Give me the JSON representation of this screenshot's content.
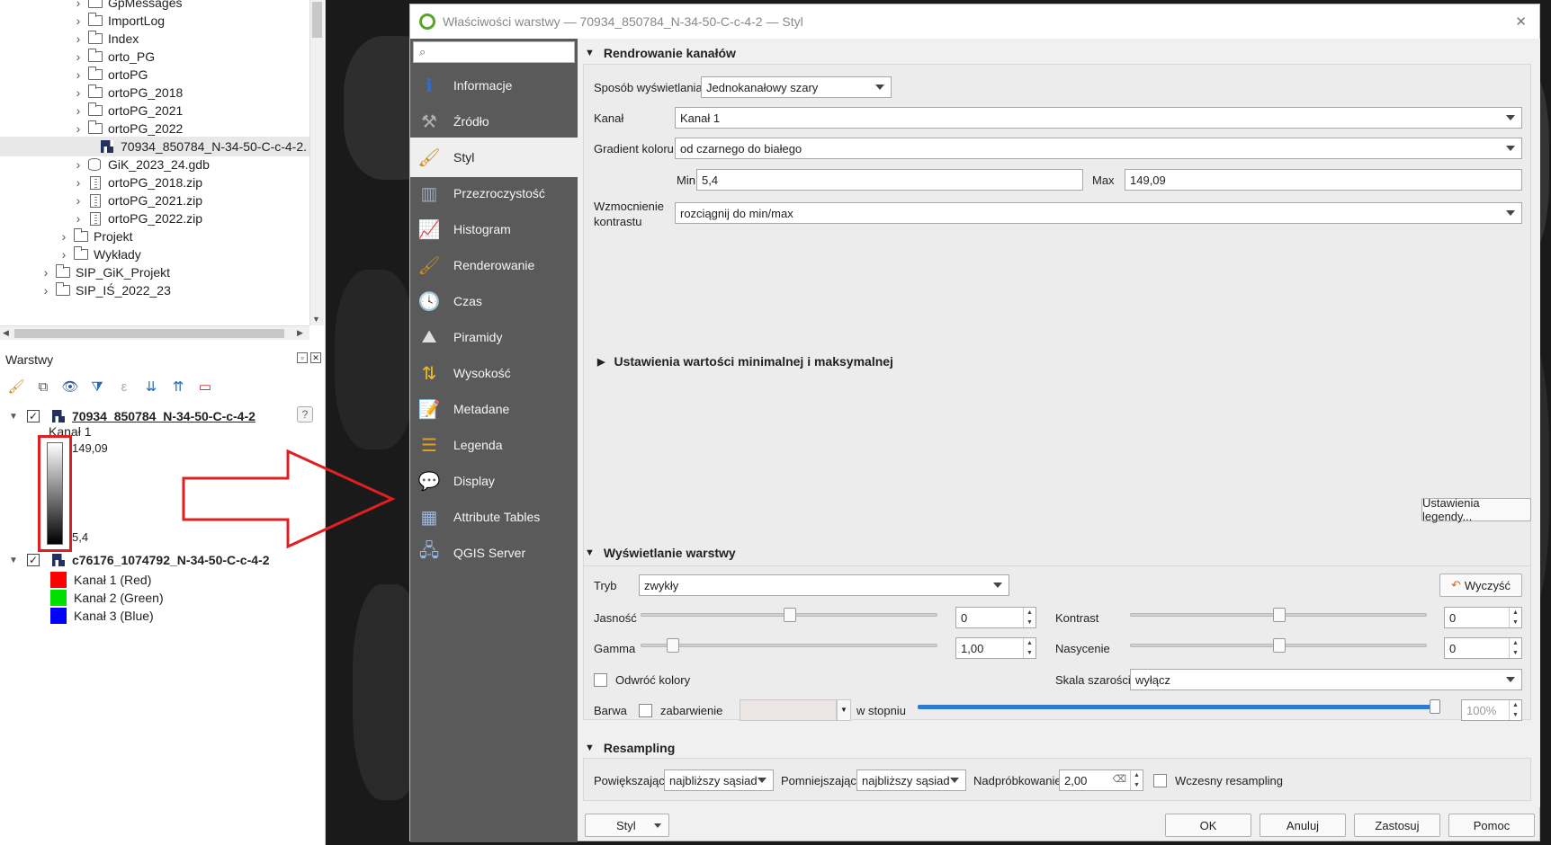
{
  "browser": {
    "items": [
      {
        "label": "GpMessages",
        "type": "folder"
      },
      {
        "label": "ImportLog",
        "type": "folder"
      },
      {
        "label": "Index",
        "type": "folder"
      },
      {
        "label": "orto_PG",
        "type": "folder"
      },
      {
        "label": "ortoPG",
        "type": "folder"
      },
      {
        "label": "ortoPG_2018",
        "type": "folder"
      },
      {
        "label": "ortoPG_2021",
        "type": "folder"
      },
      {
        "label": "ortoPG_2022",
        "type": "folder"
      },
      {
        "label": "70934_850784_N-34-50-C-c-4-2.",
        "type": "raster"
      },
      {
        "label": "GiK_2023_24.gdb",
        "type": "db"
      },
      {
        "label": "ortoPG_2018.zip",
        "type": "zip"
      },
      {
        "label": "ortoPG_2021.zip",
        "type": "zip"
      },
      {
        "label": "ortoPG_2022.zip",
        "type": "zip"
      },
      {
        "label": "Projekt",
        "type": "folder"
      },
      {
        "label": "Wykłady",
        "type": "folder"
      },
      {
        "label": "SIP_GiK_Projekt",
        "type": "folder"
      },
      {
        "label": "SIP_IŚ_2022_23",
        "type": "folder"
      }
    ]
  },
  "layers": {
    "title": "Warstwy",
    "layer1": {
      "name": "70934_850784_N-34-50-C-c-4-2",
      "band": "Kanał 1",
      "max": "149,09",
      "min": "5,4"
    },
    "layer2": {
      "name": "c76176_1074792_N-34-50-C-c-4-2",
      "bands": [
        {
          "label": "Kanał 1 (Red)",
          "color": "#ff0000"
        },
        {
          "label": "Kanał 2 (Green)",
          "color": "#00e000"
        },
        {
          "label": "Kanał 3 (Blue)",
          "color": "#0000ff"
        }
      ]
    },
    "help_icon": "?"
  },
  "dialog": {
    "title": "Właściwości warstwy — 70934_850784_N-34-50-C-c-4-2 — Styl",
    "close": "✕",
    "sidebar": [
      {
        "label": "Informacje",
        "icon": "info-icon",
        "glyph": "ℹ"
      },
      {
        "label": "Źródło",
        "icon": "source-tools-icon",
        "glyph": "⚒"
      },
      {
        "label": "Styl",
        "icon": "style-brush-icon",
        "glyph": "🖌"
      },
      {
        "label": "Przezroczystość",
        "icon": "transparency-icon",
        "glyph": "▥"
      },
      {
        "label": "Histogram",
        "icon": "histogram-icon",
        "glyph": "📈"
      },
      {
        "label": "Renderowanie",
        "icon": "rendering-icon",
        "glyph": "🖌"
      },
      {
        "label": "Czas",
        "icon": "clock-icon",
        "glyph": "🕓"
      },
      {
        "label": "Piramidy",
        "icon": "pyramids-icon",
        "glyph": "⛰"
      },
      {
        "label": "Wysokość",
        "icon": "elevation-icon",
        "glyph": "⇅"
      },
      {
        "label": "Metadane",
        "icon": "metadata-icon",
        "glyph": "📝"
      },
      {
        "label": "Legenda",
        "icon": "legend-icon",
        "glyph": "☰"
      },
      {
        "label": "Display",
        "icon": "display-tooltip-icon",
        "glyph": "💬"
      },
      {
        "label": "Attribute Tables",
        "icon": "attribute-table-icon",
        "glyph": "▦"
      },
      {
        "label": "QGIS Server",
        "icon": "qgis-server-icon",
        "glyph": "🖧"
      }
    ],
    "band_rendering": {
      "header": "Rendrowanie kanałów",
      "render_type_label": "Sposób wyświetlania",
      "render_type_value": "Jednokanałowy szary",
      "band_label": "Kanał",
      "band_value": "Kanał 1",
      "gradient_label": "Gradient koloru",
      "gradient_value": "od czarnego do białego",
      "min_label": "Min",
      "min_value": "5,4",
      "max_label": "Max",
      "max_value": "149,09",
      "contrast_label_1": "Wzmocnienie",
      "contrast_label_2": "kontrastu",
      "contrast_value": "rozciągnij do min/max",
      "minmax_settings": "Ustawienia wartości minimalnej i maksymalnej",
      "legend_settings_button": "Ustawienia legendy..."
    },
    "layer_rendering": {
      "header": "Wyświetlanie warstwy",
      "mode_label": "Tryb",
      "mode_value": "zwykły",
      "reset_button": "Wyczyść",
      "brightness_label": "Jasność",
      "brightness_value": "0",
      "contrast_label": "Kontrast",
      "contrast_value": "0",
      "gamma_label": "Gamma",
      "gamma_value": "1,00",
      "saturation_label": "Nasycenie",
      "saturation_value": "0",
      "invert_label": "Odwróć kolory",
      "grayscale_label": "Skala szarości",
      "grayscale_value": "wyłącz",
      "hue_label": "Barwa",
      "colorize_label": "zabarwienie",
      "strength_label": "w stopniu",
      "strength_value": "100%"
    },
    "resampling": {
      "header": "Resampling",
      "zoomed_in_label": "Powiększając",
      "zoomed_in_value": "najbliższy sąsiad",
      "zoomed_out_label": "Pomniejszając",
      "zoomed_out_value": "najbliższy sąsiad",
      "oversampling_label": "Nadpróbkowanie",
      "oversampling_value": "2,00",
      "early_label": "Wczesny resampling"
    },
    "footer": {
      "style_button": "Styl",
      "ok": "OK",
      "cancel": "Anuluj",
      "apply": "Zastosuj",
      "help": "Pomoc"
    }
  },
  "colors": {
    "sidebar_bg": "#5a5a5a",
    "map_bg": "#1a1a1a",
    "highlight_red": "#e02020",
    "strength_slider": "#2e7bcf"
  }
}
